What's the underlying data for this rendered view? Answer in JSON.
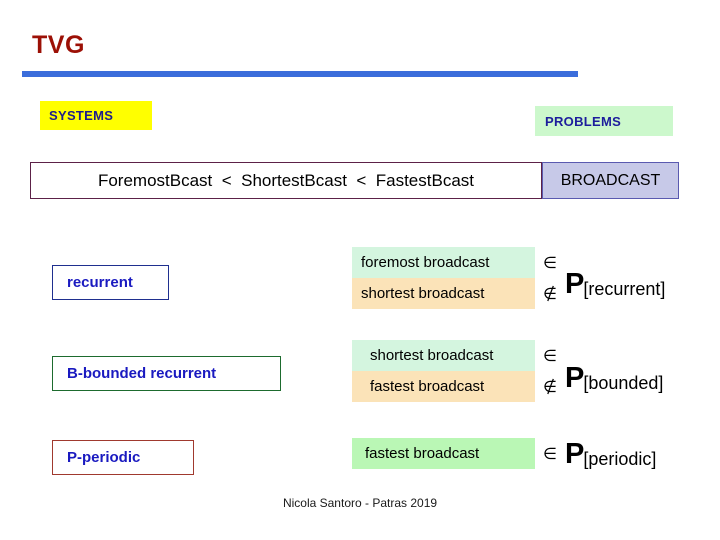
{
  "slide": {
    "title": "TVG",
    "footer": "Nicola Santoro - Patras 2019",
    "accent_rule_color": "#3b6ddb",
    "title_color": "#9c1006"
  },
  "tags": {
    "systems": {
      "label": "SYSTEMS",
      "bg": "#ffff00",
      "fg": "#1d1d8c"
    },
    "problems": {
      "label": "PROBLEMS",
      "bg": "#ccf8cc",
      "fg": "#1d1d9c"
    }
  },
  "hierarchy": {
    "formula": "ForemostBcast  <  ShortestBcast  <  FastestBcast",
    "category": "BROADCAST",
    "category_bg": "#c7c9e8"
  },
  "rows": [
    {
      "system": {
        "label": "recurrent",
        "border_color": "#1f2f8f",
        "text_color": "#1a1ac0"
      },
      "problems": [
        {
          "label": "foremost broadcast",
          "membership": "∈",
          "bg": "#d4f5df"
        },
        {
          "label": "shortest broadcast",
          "membership": "∉",
          "bg": "#fbe3b8"
        }
      ],
      "class": {
        "symbol": "P",
        "subscript": "[recurrent]"
      }
    },
    {
      "system": {
        "label": "B-bounded recurrent",
        "border_color": "#1d6b2e",
        "text_color": "#1a1ac0"
      },
      "problems": [
        {
          "label": "shortest broadcast",
          "membership": "∈",
          "bg": "#d4f5df"
        },
        {
          "label": "fastest broadcast",
          "membership": "∉",
          "bg": "#fbe3b8"
        }
      ],
      "class": {
        "symbol": "P",
        "subscript": "[bounded]"
      }
    },
    {
      "system": {
        "label": "P-periodic",
        "border_color": "#a0392e",
        "text_color": "#1a1ac0"
      },
      "problems": [
        {
          "label": "fastest broadcast",
          "membership": "∈",
          "bg": "#baf7b5"
        }
      ],
      "class": {
        "symbol": "P",
        "subscript": "[periodic]"
      }
    }
  ]
}
